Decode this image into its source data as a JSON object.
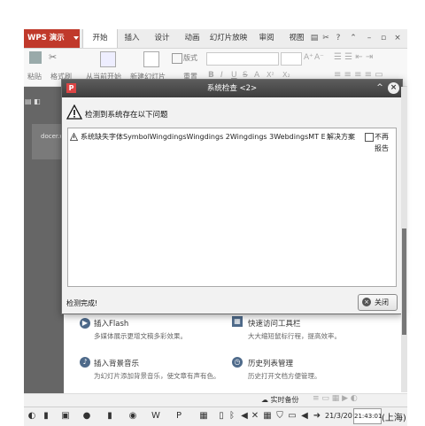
{
  "app": {
    "name": "WPS 演示",
    "tabs": [
      "开始",
      "插入",
      "设计",
      "动画",
      "幻灯片放映",
      "审阅",
      "视图"
    ],
    "active_tab": "开始"
  },
  "toolbar": {
    "paste": "粘贴",
    "format_painter": "格式刷",
    "from_current": "从当前开始",
    "new_slide": "新建幻灯片",
    "reset": "重置",
    "layout": "版式",
    "font_grow": "A",
    "font_shrink": "A",
    "bold": "B",
    "italic": "I",
    "underline": "U",
    "strike": "S",
    "font_color": "A",
    "superscript": "X²",
    "subscript": "X₂"
  },
  "left_pane": {
    "thumb_label": "docer.w"
  },
  "dialog": {
    "title": "系统检查 <2>",
    "heading": "检测到系统存在以下问题",
    "issues": [
      {
        "text": "系统缺失字体SymbolWingdingsWingdings 2Wingdings 3WebdingsMT ExtraWPS...",
        "link": "解决方案",
        "checkbox_label": "不再报告"
      }
    ],
    "status": "检测完成!",
    "close_button": "关闭"
  },
  "backdrop_cards": [
    {
      "title": "插入Flash",
      "sub": "多媒体展示更增文稿多彩效果。"
    },
    {
      "title": "快速访问工具栏",
      "sub": "大大缩短鼠标行程，提高效率。"
    },
    {
      "title": "插入背景音乐",
      "sub": "为幻灯片添加背景音乐，使文章有声有色。"
    },
    {
      "title": "历史列表管理",
      "sub": "历史打开文档方便管理。"
    }
  ],
  "statusbar": {
    "backup": "实时备份"
  },
  "taskbar": {
    "date": "21/3/20",
    "time": "21:43:01",
    "location": "(上海)"
  },
  "colors": {
    "brand": "#c0392b",
    "dialog_title": "#4a4a4a"
  }
}
